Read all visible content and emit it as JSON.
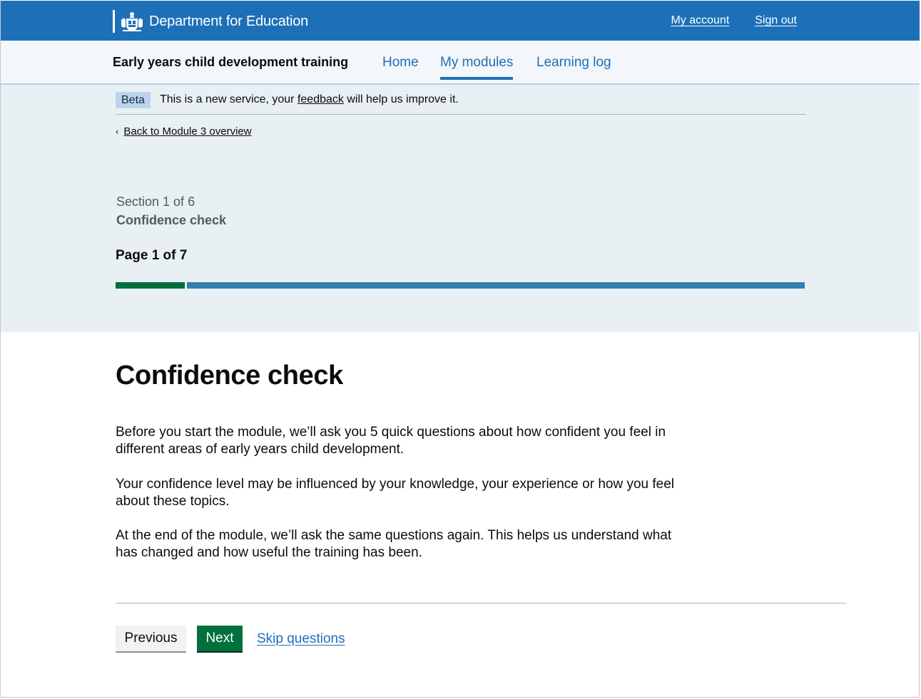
{
  "header": {
    "org_name": "Department for Education",
    "crest": "royal-crest-icon",
    "links": {
      "account": "My account",
      "sign_out": "Sign out"
    }
  },
  "service_nav": {
    "service_name": "Early years child development training",
    "items": [
      {
        "label": "Home",
        "active": false
      },
      {
        "label": "My modules",
        "active": true
      },
      {
        "label": "Learning log",
        "active": false
      }
    ]
  },
  "phase_banner": {
    "tag": "Beta",
    "text_before": "This is a new service, your ",
    "link": "feedback",
    "text_after": " will help us improve it."
  },
  "back_link": {
    "label": "Back to Module 3 overview",
    "icon": "chevron-left-icon"
  },
  "progress": {
    "section_count": "Section 1 of 6",
    "section_title": "Confidence check",
    "page_count": "Page 1 of 7",
    "fraction_complete": 0.1
  },
  "main": {
    "title": "Confidence check",
    "paragraphs": [
      "Before you start the module, we’ll ask you 5 quick questions about how confident you feel in different areas of early years child development.",
      "Your confidence level may be influenced by your knowledge, your experience or how you feel about these topics.",
      "At the end of the module, we’ll ask the same questions again. This helps us understand what has changed and how useful the training has been."
    ]
  },
  "actions": {
    "previous": "Previous",
    "next": "Next",
    "skip": "Skip questions"
  },
  "colors": {
    "brand_blue": "#1d70b8",
    "band_bg": "#e8f0f4",
    "success_green": "#00703c",
    "progress_remaining": "#347fb0"
  }
}
